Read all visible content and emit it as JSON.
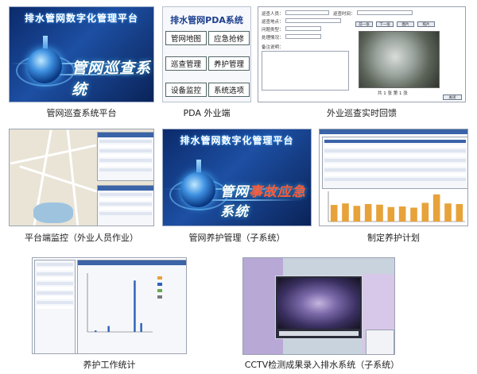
{
  "tiles": {
    "platform": {
      "banner_title": "排水管网数字化管理平台",
      "system_title": "管网巡查系统",
      "caption": "管网巡查系统平台"
    },
    "pda": {
      "title": "排水管网PDA系统",
      "buttons": [
        "管网地图",
        "应急抢修",
        "巡查管理",
        "养护管理",
        "设备监控",
        "系统选项"
      ],
      "caption": "PDA 外业端"
    },
    "feedback": {
      "field_labels": [
        "巡查人员：",
        "巡查时间：",
        "巡查地点：",
        "问题类型：",
        "处理情况：",
        "备注说明："
      ],
      "nav_buttons": [
        "前一张",
        "下一张",
        "图片",
        "照片"
      ],
      "pager_text": "共 1 张  第 1 张",
      "confirm_button": "关闭",
      "caption": "外业巡查实时回馈"
    },
    "monitor": {
      "caption": "平台端监控（外业人员作业）"
    },
    "maintenance": {
      "banner_title": "排水管网数字化管理平台",
      "system_title_a": "管网",
      "system_title_b": "事故应急",
      "system_title_c": "系统",
      "caption": "管网养护管理（子系统）"
    },
    "plan": {
      "caption": "制定养护计划",
      "chart_data": {
        "type": "bar",
        "categories": [
          "1",
          "2",
          "3",
          "4",
          "5",
          "6",
          "7",
          "8",
          "9",
          "10",
          "11",
          "12"
        ],
        "values": [
          55,
          60,
          52,
          58,
          56,
          48,
          50,
          46,
          62,
          90,
          60,
          58
        ],
        "ylim": [
          0,
          100
        ]
      }
    },
    "stats": {
      "caption": "养护工作统计",
      "chart_data": {
        "type": "bar",
        "categories": [
          "1",
          "2",
          "3",
          "4",
          "5",
          "6",
          "7",
          "8",
          "9",
          "10",
          "11",
          "12",
          "13",
          "14",
          "15",
          "16",
          "17",
          "18",
          "19",
          "20"
        ],
        "values": [
          0,
          0,
          2,
          0,
          0,
          0,
          8,
          0,
          0,
          0,
          0,
          0,
          0,
          0,
          70,
          0,
          12,
          0,
          0,
          0
        ],
        "ylim": [
          0,
          80
        ]
      }
    },
    "cctv": {
      "caption": "CCTV检测成果录入排水系统（子系统）"
    }
  },
  "colors": {
    "banner_dark": "#0b2a6b",
    "banner_light": "#1d4fa3",
    "bar_orange": "#e8a23a",
    "bar_blue": "#2f63b8",
    "title_blue": "#1c3f8f"
  }
}
